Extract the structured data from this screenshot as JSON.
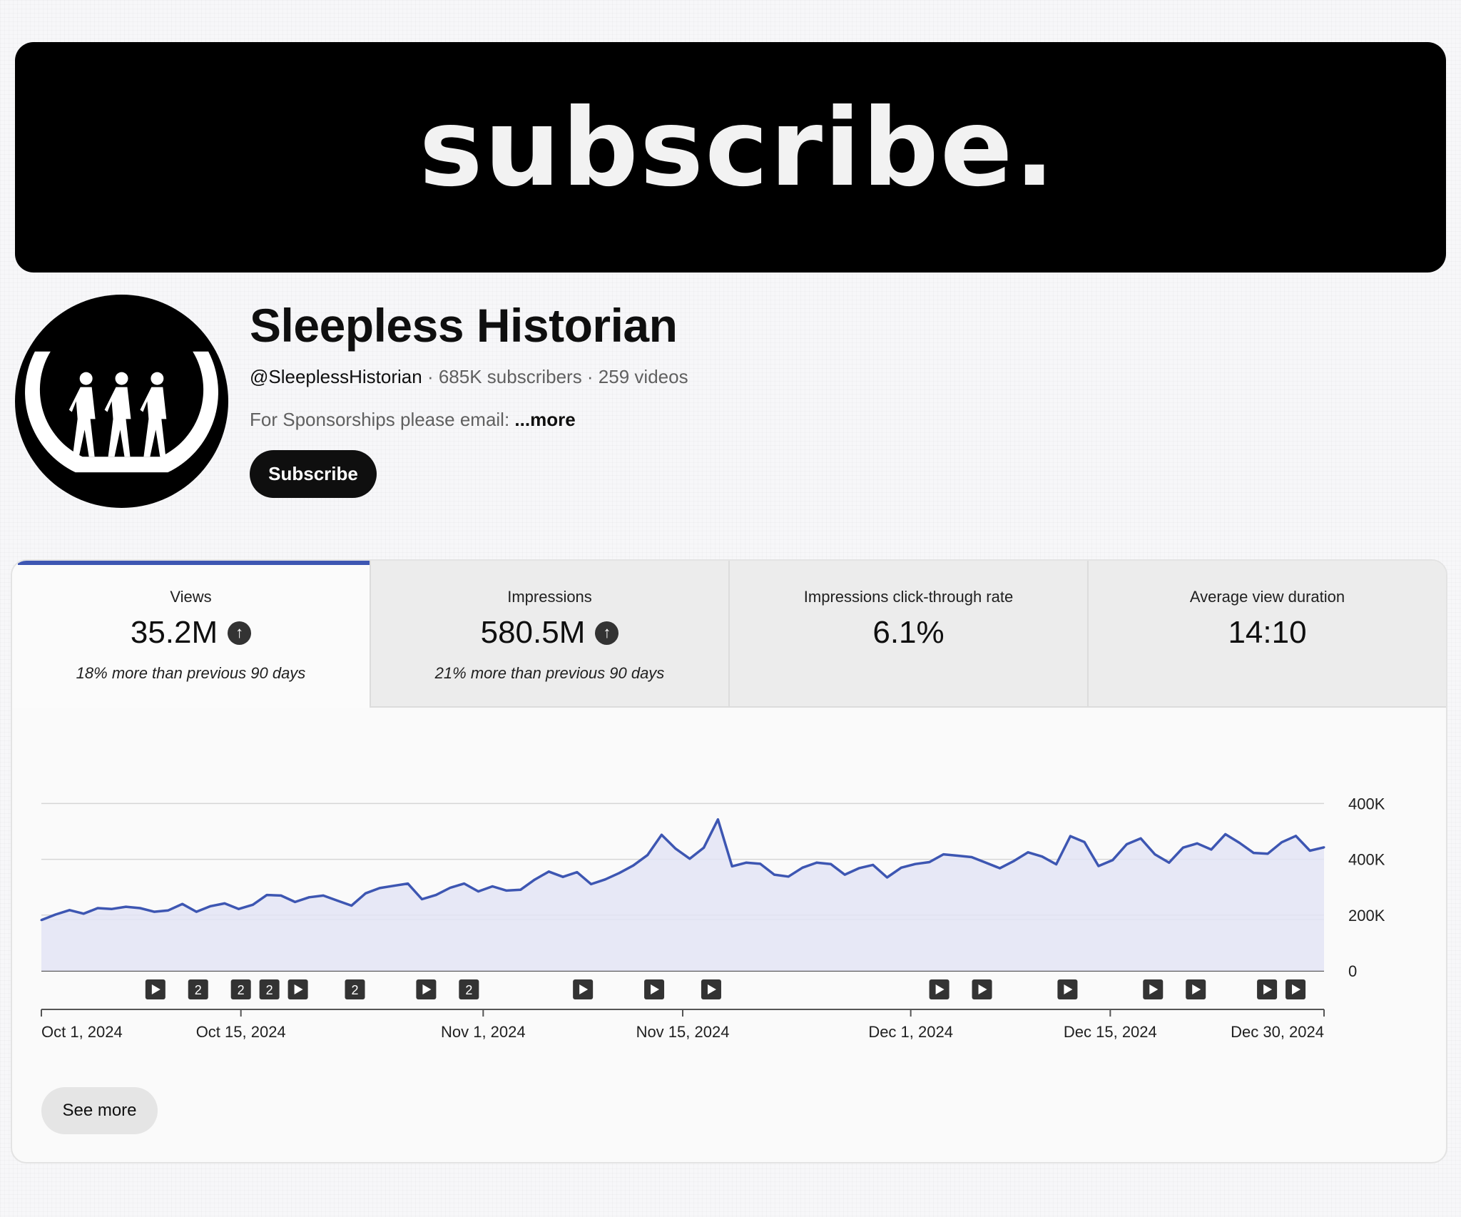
{
  "banner": {
    "text": "subscribe."
  },
  "channel": {
    "name": "Sleepless Historian",
    "handle": "@SleeplessHistorian",
    "stats": " · 685K subscribers · 259 videos",
    "description": "For Sponsorships please email: ",
    "more_label": "...more",
    "subscribe_label": "Subscribe"
  },
  "tabs": [
    {
      "label": "Views",
      "value": "35.2M",
      "compare": "18% more than previous 90 days",
      "trend_icon": "arrow-up-icon",
      "active": true
    },
    {
      "label": "Impressions",
      "value": "580.5M",
      "compare": "21% more than previous 90 days",
      "trend_icon": "arrow-up-icon",
      "active": false
    },
    {
      "label": "Impressions click-through rate",
      "value": "6.1%",
      "compare": "",
      "active": false
    },
    {
      "label": "Average view duration",
      "value": "14:10",
      "compare": "",
      "active": false
    }
  ],
  "see_more_label": "See more",
  "colors": {
    "accent": "#3d56b2",
    "area_fill": "#e3e4f5",
    "banner": "#000000",
    "button": "#0f0f0f"
  },
  "chart_data": {
    "type": "area",
    "x_start": "Oct 1, 2024",
    "x_end": "Dec 30, 2024",
    "x_tick_labels": [
      "Oct 1, 2024",
      "Oct 15, 2024",
      "Nov 1, 2024",
      "Nov 15, 2024",
      "Dec 1, 2024",
      "Dec 15, 2024",
      "Dec 30, 2024"
    ],
    "y_tick_labels": [
      "0",
      "200K",
      "400K",
      "400K"
    ],
    "y_tick_values": [
      0,
      200000,
      400000,
      600000
    ],
    "ylim": [
      0,
      690000
    ],
    "grid": true,
    "series": [
      {
        "values": [
          182000,
          202000,
          218000,
          205000,
          225000,
          222000,
          230000,
          225000,
          212000,
          217000,
          240000,
          212000,
          232000,
          242000,
          222000,
          237000,
          272000,
          270000,
          247000,
          264000,
          270000,
          252000,
          234000,
          278000,
          297000,
          305000,
          313000,
          257000,
          272000,
          298000,
          313000,
          285000,
          303000,
          288000,
          291000,
          327000,
          356000,
          337000,
          354000,
          311000,
          328000,
          351000,
          378000,
          415000,
          488000,
          438000,
          402000,
          442000,
          543000,
          375000,
          388000,
          384000,
          345000,
          338000,
          370000,
          388000,
          383000,
          345000,
          368000,
          380000,
          335000,
          370000,
          383000,
          390000,
          418000,
          413000,
          408000,
          388000,
          368000,
          394000,
          425000,
          410000,
          382000,
          483000,
          462000,
          376000,
          397000,
          454000,
          475000,
          418000,
          388000,
          442000,
          457000,
          435000,
          490000,
          459000,
          423000,
          420000,
          461000,
          484000,
          431000,
          443000
        ]
      }
    ],
    "video_markers": [
      {
        "date": "Oct 9, 2024",
        "label": ""
      },
      {
        "date": "Oct 12, 2024",
        "label": "2"
      },
      {
        "date": "Oct 15, 2024",
        "label": "2"
      },
      {
        "date": "Oct 17, 2024",
        "label": "2"
      },
      {
        "date": "Oct 19, 2024",
        "label": ""
      },
      {
        "date": "Oct 23, 2024",
        "label": "2"
      },
      {
        "date": "Oct 28, 2024",
        "label": ""
      },
      {
        "date": "Oct 31, 2024",
        "label": "2"
      },
      {
        "date": "Nov 8, 2024",
        "label": ""
      },
      {
        "date": "Nov 13, 2024",
        "label": ""
      },
      {
        "date": "Nov 17, 2024",
        "label": ""
      },
      {
        "date": "Dec 3, 2024",
        "label": ""
      },
      {
        "date": "Dec 6, 2024",
        "label": ""
      },
      {
        "date": "Dec 12, 2024",
        "label": ""
      },
      {
        "date": "Dec 18, 2024",
        "label": ""
      },
      {
        "date": "Dec 21, 2024",
        "label": ""
      },
      {
        "date": "Dec 26, 2024",
        "label": ""
      },
      {
        "date": "Dec 28, 2024",
        "label": ""
      }
    ]
  }
}
